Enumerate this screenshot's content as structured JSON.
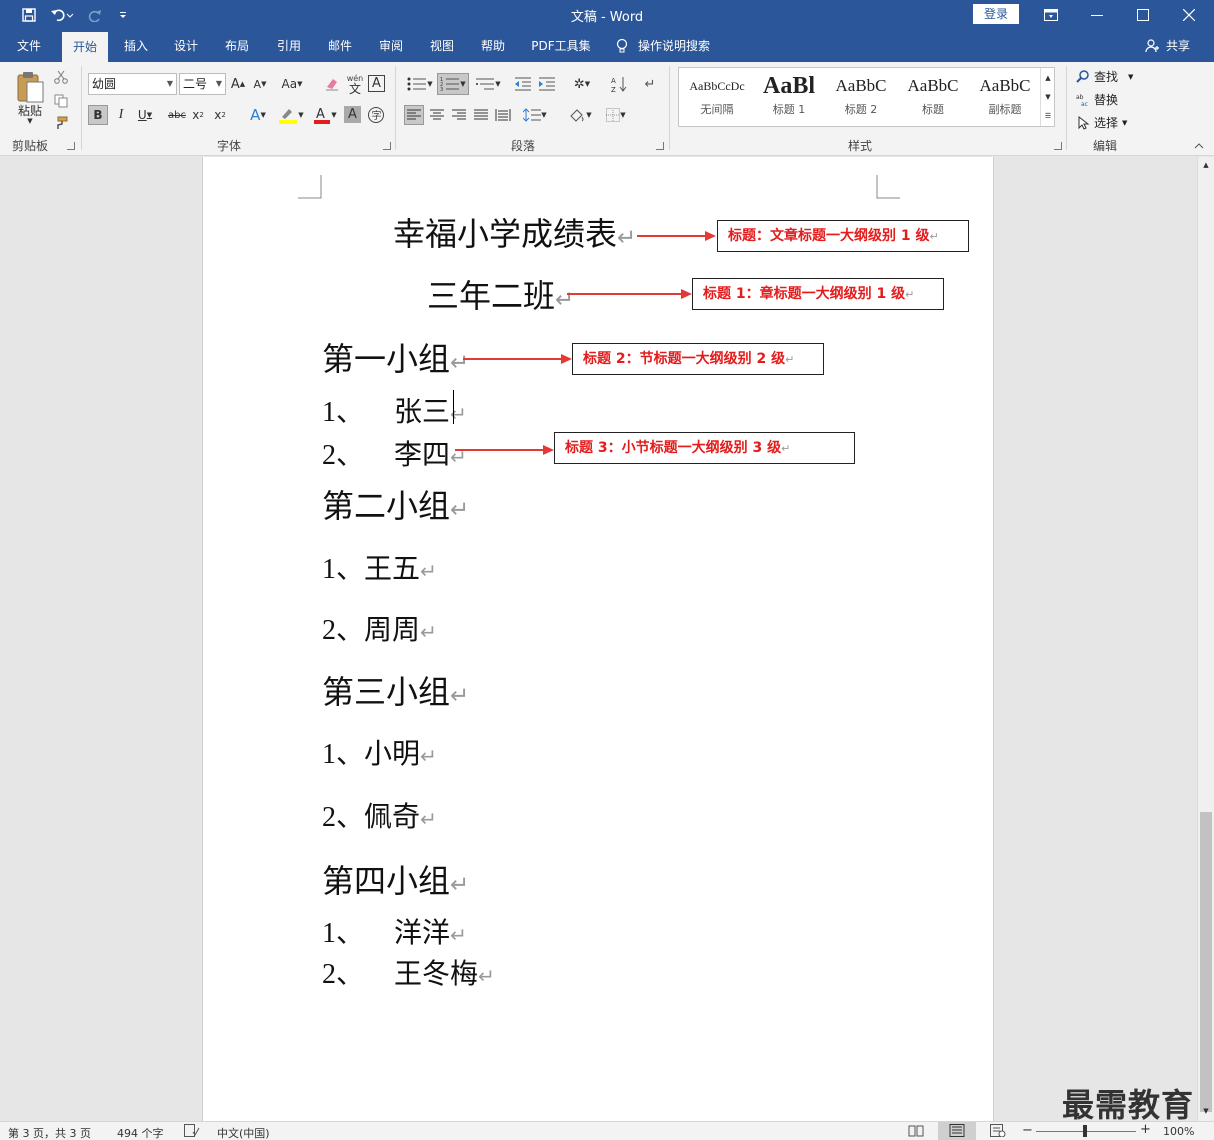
{
  "window": {
    "title": "文稿  -  Word",
    "login_label": "登录",
    "share_label": "共享"
  },
  "tabs": [
    "文件",
    "开始",
    "插入",
    "设计",
    "布局",
    "引用",
    "邮件",
    "审阅",
    "视图",
    "帮助",
    "PDF工具集"
  ],
  "active_tab": "开始",
  "tell_me": "操作说明搜索",
  "ribbon": {
    "clipboard": {
      "label": "剪贴板",
      "paste": "粘贴"
    },
    "font": {
      "label": "字体",
      "font_name": "幼圆",
      "font_size": "二号",
      "change_case": "Aa",
      "phonetic": "wén",
      "phonetic_char": "文"
    },
    "paragraph": {
      "label": "段落"
    },
    "styles": {
      "label": "样式",
      "items": [
        {
          "preview": "AaBbCcDc",
          "name": "无间隔"
        },
        {
          "preview": "AaBl",
          "name": "标题 1"
        },
        {
          "preview": "AaBbC",
          "name": "标题 2"
        },
        {
          "preview": "AaBbC",
          "name": "标题"
        },
        {
          "preview": "AaBbC",
          "name": "副标题"
        }
      ]
    },
    "editing": {
      "label": "编辑",
      "find": "查找",
      "replace": "替换",
      "select": "选择"
    }
  },
  "document": {
    "title": "幸福小学成绩表",
    "class": "三年二班",
    "groups": [
      {
        "heading": "第一小组",
        "items": [
          {
            "num": "1、",
            "name": "张三"
          },
          {
            "num": "2、",
            "name": "李四"
          }
        ]
      },
      {
        "heading": "第二小组",
        "items": [
          {
            "num": "1、",
            "name": "王五"
          },
          {
            "num": "2、",
            "name": "周周"
          }
        ]
      },
      {
        "heading": "第三小组",
        "items": [
          {
            "num": "1、",
            "name": "小明"
          },
          {
            "num": "2、",
            "name": "佩奇"
          }
        ]
      },
      {
        "heading": "第四小组",
        "items": [
          {
            "num": "1、",
            "name": "洋洋"
          },
          {
            "num": "2、",
            "name": "王冬梅"
          }
        ]
      }
    ],
    "callouts": [
      "标题：文章标题一大纲级别 1 级",
      "标题 1：章标题一大纲级别 1 级",
      "标题 2：节标题一大纲级别 2 级",
      "标题 3：小节标题一大纲级别 3 级"
    ],
    "para_mark": "↵"
  },
  "status": {
    "page": "第 3 页，共 3 页",
    "words": "494 个字",
    "language": "中文(中国)",
    "zoom": "100%"
  },
  "watermark": "最需教育",
  "colors": {
    "accent": "#2b579a",
    "callout_text": "#e31c1c",
    "arrow": "#e53935"
  }
}
